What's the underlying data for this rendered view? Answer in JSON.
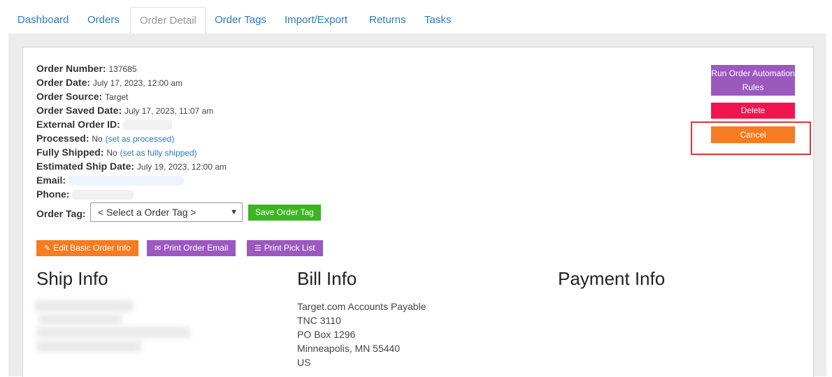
{
  "tabs": [
    "Dashboard",
    "Orders",
    "Order Detail",
    "Order Tags",
    "Import/Export",
    "Returns",
    "Tasks"
  ],
  "active_tab": "Order Detail",
  "order": {
    "number_label": "Order Number:",
    "number": "137685",
    "date_label": "Order Date:",
    "date": "July 17, 2023, 12:00 am",
    "source_label": "Order Source:",
    "source": "Target",
    "saved_label": "Order Saved Date:",
    "saved": "July 17, 2023, 11:07 am",
    "external_label": "External Order ID:",
    "processed_label": "Processed:",
    "processed": "No",
    "processed_link": "(set as processed)",
    "shipped_label": "Fully Shipped:",
    "shipped": "No",
    "shipped_link": "(set as fully shipped)",
    "est_ship_label": "Estimated Ship Date:",
    "est_ship": "July 19, 2023, 12:00 am",
    "email_label": "Email:",
    "phone_label": "Phone:"
  },
  "order_tag": {
    "label": "Order Tag:",
    "selected": "< Select a Order Tag >",
    "save_button": "Save Order Tag"
  },
  "actions": {
    "edit": "Edit Basic Order Info",
    "print_email": "Print Order Email",
    "print_pick": "Print Pick List"
  },
  "side_actions": {
    "run_rules": "Run Order Automation Rules",
    "delete": "Delete",
    "cancel": "Cancel"
  },
  "sections": {
    "ship": "Ship Info",
    "bill": "Bill Info",
    "payment": "Payment Info"
  },
  "bill_info": [
    "Target.com Accounts Payable",
    "TNC 3110",
    "PO Box 1296",
    "Minneapolis, MN 55440",
    "US"
  ],
  "colors": {
    "link": "#2a7bc0",
    "green": "#3cb521",
    "orange": "#f57c20",
    "purple": "#9b59c0",
    "red": "#f0154f",
    "highlight": "#d9363e"
  }
}
